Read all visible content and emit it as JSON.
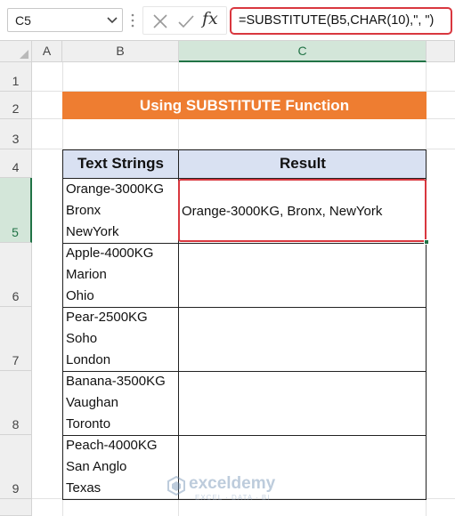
{
  "formula_bar": {
    "name_box": "C5",
    "formula": "=SUBSTITUTE(B5,CHAR(10),\", \")",
    "fx_label": "fx"
  },
  "columns": [
    "A",
    "B",
    "C"
  ],
  "rows": [
    "1",
    "2",
    "3",
    "4",
    "5",
    "6",
    "7",
    "8",
    "9"
  ],
  "title": "Using SUBSTITUTE Function",
  "table": {
    "headers": [
      "Text Strings",
      "Result"
    ],
    "rows": [
      {
        "lines": [
          "Orange-3000KG",
          "Bronx",
          "NewYork"
        ],
        "result": "Orange-3000KG, Bronx, NewYork"
      },
      {
        "lines": [
          "Apple-4000KG",
          "Marion",
          "Ohio"
        ],
        "result": ""
      },
      {
        "lines": [
          "Pear-2500KG",
          "Soho",
          "London"
        ],
        "result": ""
      },
      {
        "lines": [
          "Banana-3500KG",
          "Vaughan",
          "Toronto"
        ],
        "result": ""
      },
      {
        "lines": [
          "Peach-4000KG",
          "San Anglo",
          "Texas"
        ],
        "result": ""
      }
    ]
  },
  "watermark": {
    "name": "exceldemy",
    "tagline": "EXCEL · DATA · BI"
  },
  "colors": {
    "accent": "#ee7d31",
    "header_fill": "#d9e1f2",
    "highlight": "#d9373f",
    "excel_green": "#217346"
  }
}
